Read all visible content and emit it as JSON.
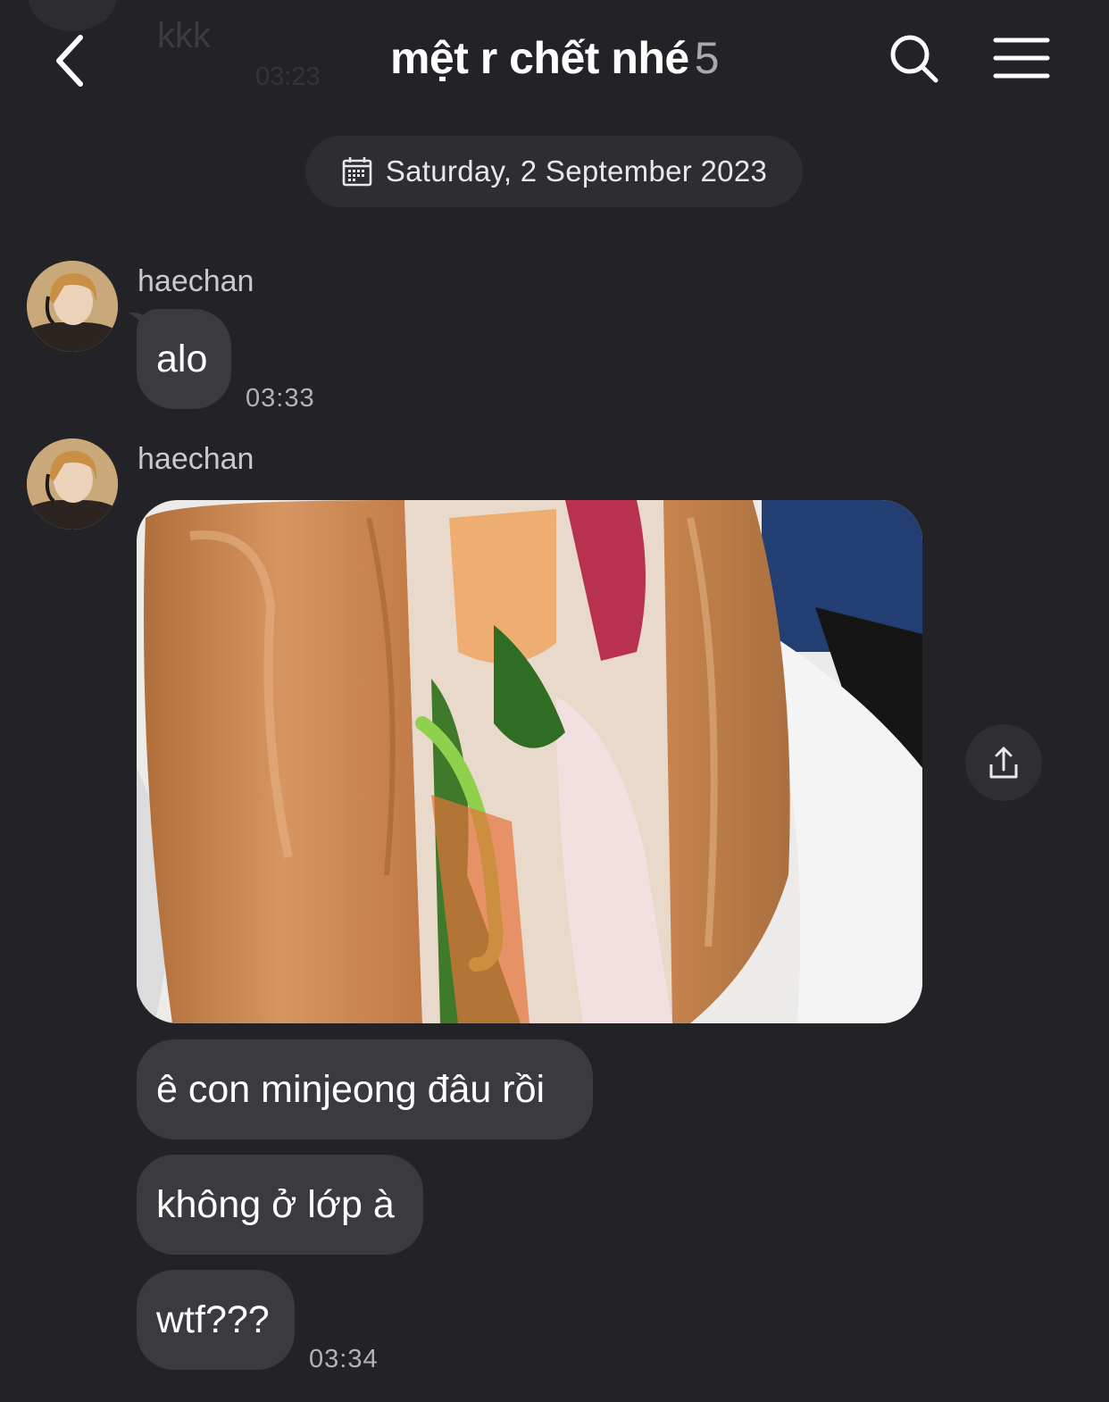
{
  "ghost": {
    "text": "kkk",
    "time": "03:23"
  },
  "header": {
    "title": "mệt r chết nhé",
    "member_count": "5"
  },
  "date_separator": "Saturday, 2 September 2023",
  "messages": [
    {
      "sender": "haechan",
      "text": "alo",
      "time": "03:33"
    },
    {
      "sender": "haechan",
      "image": "sandwich-photo"
    },
    {
      "text": "ê con minjeong đâu rồi"
    },
    {
      "text": "không ở lớp à"
    },
    {
      "text": "wtf???",
      "time": "03:34"
    }
  ],
  "colors": {
    "background": "#232327",
    "bubble": "#3a3a3f",
    "pill": "#2d2d32",
    "muted": "#b3b3b7"
  },
  "icons": [
    "back-chevron-icon",
    "search-icon",
    "menu-icon",
    "calendar-icon",
    "share-icon"
  ]
}
